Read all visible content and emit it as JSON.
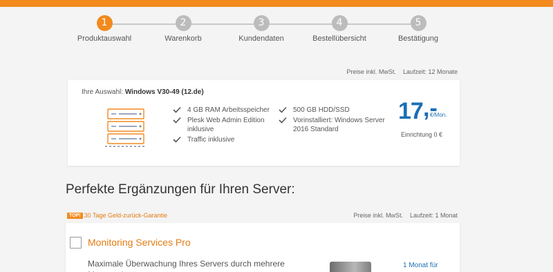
{
  "brand": {
    "accent": "#f28a1e",
    "price_blue": "#1b6fb5"
  },
  "steps": [
    {
      "number": "1",
      "label": "Produktauswahl",
      "active": true
    },
    {
      "number": "2",
      "label": "Warenkorb",
      "active": false
    },
    {
      "number": "3",
      "label": "Kundendaten",
      "active": false
    },
    {
      "number": "4",
      "label": "Bestellübersicht",
      "active": false
    },
    {
      "number": "5",
      "label": "Bestätigung",
      "active": false
    }
  ],
  "selection": {
    "prices_note": "Preise inkl. MwSt.",
    "term_note": "Laufzeit: 12 Monate",
    "title_prefix": "Ihre Auswahl:",
    "title_value": "Windows V30-49 (12.de)",
    "icon": "server-rack-icon",
    "features_left": [
      "4 GB RAM Arbeitsspeicher",
      "Plesk Web Admin Edition inklusive",
      "Traffic inklusive"
    ],
    "features_right": [
      "500 GB HDD/SSD",
      "Vorinstalliert: Windows Server 2016 Standard"
    ],
    "price_main": "17",
    "price_comma": ",-",
    "price_unit": "€/Mon.",
    "setup": "Einrichtung 0 €"
  },
  "section_title": "Perfekte Ergänzungen für Ihren Server:",
  "addons": {
    "badge": "TOP!",
    "guarantee": "30 Tage Geld-zurück-Garantie",
    "prices_note": "Preise inkl. MwSt.",
    "term_note": "Laufzeit: 1 Monat",
    "items": [
      {
        "title": "Monitoring Services Pro",
        "description": "Maximale Überwachung Ihres Servers durch mehrere Messpunkte",
        "price_note": "1 Monat für"
      }
    ]
  }
}
